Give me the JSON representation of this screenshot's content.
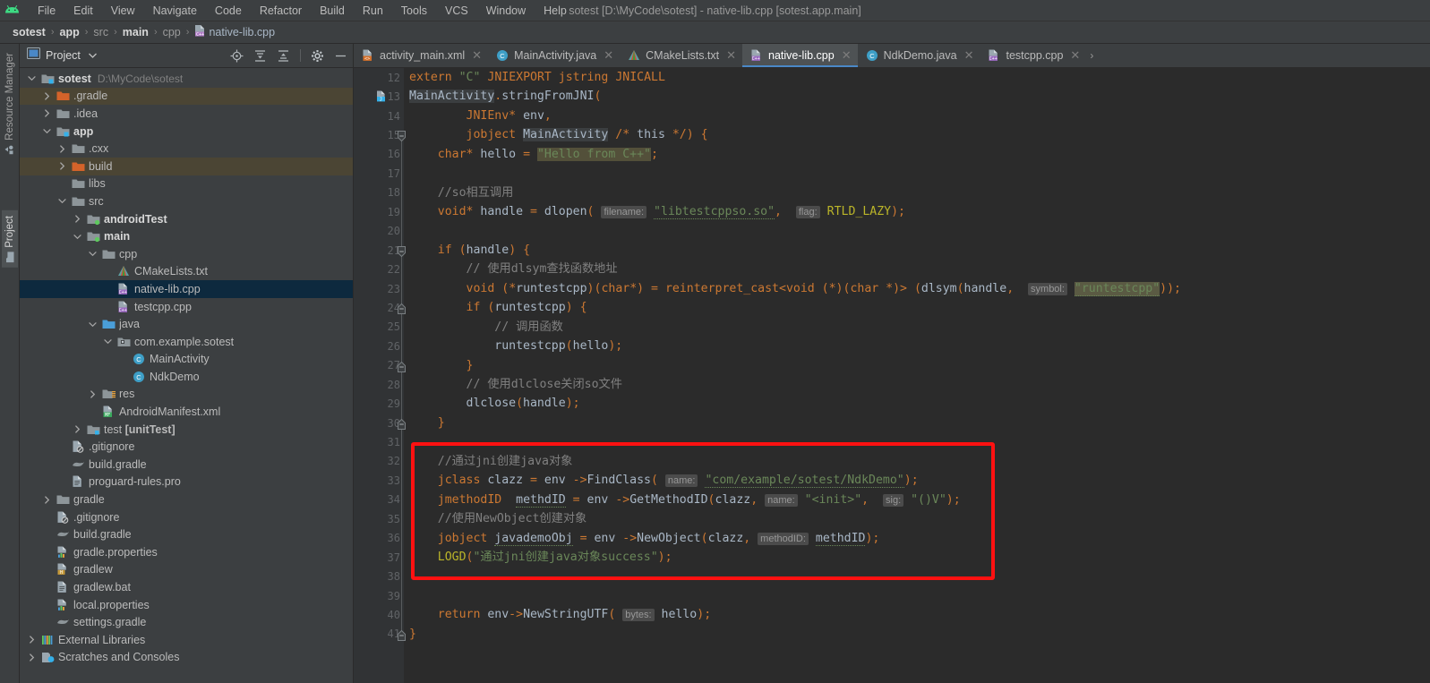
{
  "titlebar": {
    "window_title": "sotest [D:\\MyCode\\sotest] - native-lib.cpp [sotest.app.main]",
    "logo_icon": "android-studio-logo-icon",
    "menus": [
      {
        "label": "File"
      },
      {
        "label": "Edit"
      },
      {
        "label": "View"
      },
      {
        "label": "Navigate"
      },
      {
        "label": "Code"
      },
      {
        "label": "Refactor"
      },
      {
        "label": "Build"
      },
      {
        "label": "Run"
      },
      {
        "label": "Tools"
      },
      {
        "label": "VCS"
      },
      {
        "label": "Window"
      },
      {
        "label": "Help"
      }
    ]
  },
  "breadcrumb": {
    "items": [
      {
        "label": "sotest",
        "bold": true
      },
      {
        "label": "app",
        "bold": true
      },
      {
        "label": "src",
        "bold": false
      },
      {
        "label": "main",
        "bold": true
      },
      {
        "label": "cpp",
        "bold": false
      },
      {
        "label": "native-lib.cpp",
        "bold": false,
        "icon": "cpp-file-icon"
      }
    ],
    "separator": "›"
  },
  "left_strip": {
    "tabs": [
      {
        "label": "Resource Manager",
        "icon": "resource-manager-icon",
        "active": false
      },
      {
        "label": "Project",
        "icon": "project-folder-icon",
        "active": true
      }
    ]
  },
  "project_panel": {
    "title": "Project",
    "title_icon": "project-view-icon",
    "caret_icon": "chevron-down-icon",
    "tools": [
      {
        "name": "locate-target-icon",
        "label": "Select Opened File"
      },
      {
        "name": "expand-all-icon",
        "label": "Expand All"
      },
      {
        "name": "collapse-all-icon",
        "label": "Collapse All"
      },
      {
        "name": "gear-icon",
        "label": "Settings"
      },
      {
        "name": "minimize-icon",
        "label": "Hide"
      }
    ],
    "tree": [
      {
        "depth": 0,
        "label": "sotest",
        "sub": "D:\\MyCode\\sotest",
        "arrow": "down",
        "icon": "module-folder-icon",
        "bold": true,
        "state": "none"
      },
      {
        "depth": 1,
        "label": ".gradle",
        "arrow": "right",
        "icon": "orange-folder-icon",
        "bold": false,
        "state": "olive"
      },
      {
        "depth": 1,
        "label": ".idea",
        "arrow": "right",
        "icon": "folder-icon",
        "bold": false,
        "state": "none"
      },
      {
        "depth": 1,
        "label": "app",
        "arrow": "down",
        "icon": "module-folder-icon",
        "bold": true,
        "state": "none"
      },
      {
        "depth": 2,
        "label": ".cxx",
        "arrow": "right",
        "icon": "folder-icon",
        "bold": false,
        "state": "none"
      },
      {
        "depth": 2,
        "label": "build",
        "arrow": "right",
        "icon": "orange-folder-icon",
        "bold": false,
        "state": "olive"
      },
      {
        "depth": 2,
        "label": "libs",
        "arrow": "none",
        "icon": "folder-icon",
        "bold": false,
        "state": "none"
      },
      {
        "depth": 2,
        "label": "src",
        "arrow": "down",
        "icon": "folder-icon",
        "bold": false,
        "state": "none"
      },
      {
        "depth": 3,
        "label": "androidTest",
        "arrow": "right",
        "icon": "source-folder-icon",
        "bold": true,
        "state": "none"
      },
      {
        "depth": 3,
        "label": "main",
        "arrow": "down",
        "icon": "source-folder-icon",
        "bold": true,
        "state": "none"
      },
      {
        "depth": 4,
        "label": "cpp",
        "arrow": "down",
        "icon": "folder-icon",
        "bold": false,
        "state": "none"
      },
      {
        "depth": 5,
        "label": "CMakeLists.txt",
        "arrow": "none",
        "icon": "cmake-file-icon",
        "bold": false,
        "state": "none"
      },
      {
        "depth": 5,
        "label": "native-lib.cpp",
        "arrow": "none",
        "icon": "cpp-file-icon",
        "bold": false,
        "state": "selected"
      },
      {
        "depth": 5,
        "label": "testcpp.cpp",
        "arrow": "none",
        "icon": "cpp-file-icon",
        "bold": false,
        "state": "none"
      },
      {
        "depth": 4,
        "label": "java",
        "arrow": "down",
        "icon": "java-folder-icon",
        "bold": false,
        "state": "none"
      },
      {
        "depth": 5,
        "label": "com.example.sotest",
        "arrow": "down",
        "icon": "package-icon",
        "bold": false,
        "state": "none"
      },
      {
        "depth": 6,
        "label": "MainActivity",
        "arrow": "none",
        "icon": "java-class-icon",
        "bold": false,
        "state": "none"
      },
      {
        "depth": 6,
        "label": "NdkDemo",
        "arrow": "none",
        "icon": "java-class-icon",
        "bold": false,
        "state": "none"
      },
      {
        "depth": 4,
        "label": "res",
        "arrow": "right",
        "icon": "res-folder-icon",
        "bold": false,
        "state": "none"
      },
      {
        "depth": 4,
        "label": "AndroidManifest.xml",
        "arrow": "none",
        "icon": "manifest-file-icon",
        "bold": false,
        "state": "none"
      },
      {
        "depth": 3,
        "label": "test [unitTest]",
        "arrow": "right",
        "icon": "test-folder-icon",
        "bold": false,
        "state": "none"
      },
      {
        "depth": 2,
        "label": ".gitignore",
        "arrow": "none",
        "icon": "gitignore-file-icon",
        "bold": false,
        "state": "none"
      },
      {
        "depth": 2,
        "label": "build.gradle",
        "arrow": "none",
        "icon": "gradle-file-icon",
        "bold": false,
        "state": "none"
      },
      {
        "depth": 2,
        "label": "proguard-rules.pro",
        "arrow": "none",
        "icon": "text-file-icon",
        "bold": false,
        "state": "none"
      },
      {
        "depth": 1,
        "label": "gradle",
        "arrow": "right",
        "icon": "folder-icon",
        "bold": false,
        "state": "none"
      },
      {
        "depth": 1,
        "label": ".gitignore",
        "arrow": "none",
        "icon": "gitignore-file-icon",
        "bold": false,
        "state": "none"
      },
      {
        "depth": 1,
        "label": "build.gradle",
        "arrow": "none",
        "icon": "gradle-file-icon",
        "bold": false,
        "state": "none"
      },
      {
        "depth": 1,
        "label": "gradle.properties",
        "arrow": "none",
        "icon": "properties-file-icon",
        "bold": false,
        "state": "none"
      },
      {
        "depth": 1,
        "label": "gradlew",
        "arrow": "none",
        "icon": "shell-file-icon",
        "bold": false,
        "state": "none"
      },
      {
        "depth": 1,
        "label": "gradlew.bat",
        "arrow": "none",
        "icon": "text-file-icon",
        "bold": false,
        "state": "none"
      },
      {
        "depth": 1,
        "label": "local.properties",
        "arrow": "none",
        "icon": "properties-file-icon",
        "bold": false,
        "state": "none"
      },
      {
        "depth": 1,
        "label": "settings.gradle",
        "arrow": "none",
        "icon": "gradle-file-icon",
        "bold": false,
        "state": "none"
      },
      {
        "depth": 0,
        "label": "External Libraries",
        "arrow": "right",
        "icon": "libraries-icon",
        "bold": false,
        "state": "none"
      },
      {
        "depth": 0,
        "label": "Scratches and Consoles",
        "arrow": "right",
        "icon": "scratches-icon",
        "bold": false,
        "state": "none"
      }
    ]
  },
  "editor": {
    "tabs": [
      {
        "label": "activity_main.xml",
        "icon": "xml-file-icon",
        "active": false,
        "closable": true
      },
      {
        "label": "MainActivity.java",
        "icon": "java-class-icon",
        "active": false,
        "closable": true
      },
      {
        "label": "CMakeLists.txt",
        "icon": "cmake-file-icon",
        "active": false,
        "closable": true
      },
      {
        "label": "native-lib.cpp",
        "icon": "cpp-file-icon",
        "active": true,
        "closable": true
      },
      {
        "label": "NdkDemo.java",
        "icon": "java-class-icon",
        "active": false,
        "closable": true
      },
      {
        "label": "testcpp.cpp",
        "icon": "cpp-file-icon",
        "active": false,
        "closable": true
      }
    ],
    "tab_overflow": "›",
    "first_line_number": 12,
    "line_numbers": [
      12,
      13,
      14,
      15,
      16,
      17,
      18,
      19,
      20,
      21,
      22,
      23,
      24,
      25,
      26,
      27,
      28,
      29,
      30,
      31,
      32,
      33,
      34,
      35,
      36,
      37,
      38,
      39,
      40,
      41
    ],
    "code_lines": [
      "extern \"C\" JNIEXPORT jstring JNICALL",
      "MainActivity.stringFromJNI(",
      "        JNIEnv* env,",
      "        jobject MainActivity /* this */) {",
      "    char* hello = \"Hello from C++\";",
      "",
      "    //so相互调用",
      "    void* handle = dlopen( filename: \"libtestcppso.so\",  flag: RTLD_LAZY);",
      "",
      "    if (handle) {",
      "        // 使用dlsym查找函数地址",
      "        void (*runtestcpp)(char*) = reinterpret_cast<void (*)(char *)> (dlsym(handle,  symbol: \"runtestcpp\"));",
      "        if (runtestcpp) {",
      "            // 调用函数",
      "            runtestcpp(hello);",
      "        }",
      "        // 使用dlclose关闭so文件",
      "        dlclose(handle);",
      "    }",
      "",
      "    //通过jni创建java对象",
      "    jclass clazz = env ->FindClass( name: \"com/example/sotest/NdkDemo\");",
      "    jmethodID  methdID = env ->GetMethodID(clazz, name: \"<init>\",  sig: \"()V\");",
      "    //使用NewObject创建对象",
      "    jobject javademoObj = env ->NewObject(clazz, methodID: methdID);",
      "    LOGD(\"通过jni创建java对象success\");",
      "",
      "",
      "    return env->NewStringUTF( bytes: hello);",
      "}"
    ],
    "parameter_hints": [
      "filename:",
      "flag:",
      "symbol:",
      "name:",
      "name:",
      "sig:",
      "methodID:",
      "bytes:"
    ],
    "annotation_box": {
      "color": "#ff1111",
      "covers_lines": "32-38",
      "label": "red-highlight-rectangle"
    }
  },
  "colors": {
    "panel_bg": "#3c3f41",
    "editor_bg": "#2b2b2b",
    "gutter_bg": "#313335",
    "selection_blue": "#0d293e",
    "highlight_olive": "#4b4534",
    "accent_red": "#ff1111",
    "tab_active": "#4e5254",
    "text_default": "#a9b7c6",
    "keyword_orange": "#cc7832",
    "string_green": "#6a8759",
    "comment_gray": "#808080",
    "macro_yellow": "#bbb529"
  }
}
